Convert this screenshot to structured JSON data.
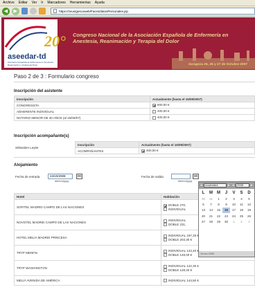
{
  "browser": {
    "menu": [
      "Archivo",
      "Editar",
      "Ver",
      "Ir",
      "Marcadores",
      "Herramientas",
      "Ayuda"
    ],
    "url": "https://zeus/gescoweb/Faces/datosPersonales.jsp"
  },
  "banner": {
    "logo_number": "20°",
    "logo_name": "aseedar-td",
    "logo_sub": "Asociación Española de Enfermería en Anestesia, Reanimación y Terapia del Dolor",
    "title": "Congreso Nacional de la Asociación Española de Enfermería en Anestesia, Reanimación y Terapia del Dolor",
    "date": "Zaragoza 25, 26 y 27 de Octubre 2007"
  },
  "step_title": "Paso 2 de 3 : Formulario congreso",
  "asistente": {
    "title": "Inscripción del asistente",
    "headers": [
      "Inscripción",
      "Actualmente (hasta el 15/09/2007)"
    ],
    "rows": [
      {
        "label": "CONGRESISTA",
        "price": "600,00 €",
        "checked": true
      },
      {
        "label": "ADHERENTE INDIVIDUAL",
        "price": "400,00 €",
        "checked": false
      },
      {
        "label": "NOTARIO MENOR DE 30 AÑOS (al 15/09/07)",
        "price": "400,00 €",
        "checked": false
      }
    ]
  },
  "acompanantes": {
    "title": "Inscripción acompañante(s)",
    "name": "Sébastien Leyter",
    "headers": [
      "Inscripción",
      "Actualmente (hasta el 15/09/2007)"
    ],
    "rows": [
      {
        "label": "ACOMPAÑANTES",
        "price": "400,00 €",
        "checked": true
      }
    ]
  },
  "alojamiento": {
    "title": "Alojamiento",
    "entrada_label": "Fecha de entrada",
    "entrada_value": "24/10/2008",
    "entrada_format": "dd/mm/yyyy",
    "salida_label": "Fecha de salida",
    "salida_value": "",
    "salida_format": "dd/mm/yyyy",
    "headers": [
      "Hotel",
      "Habitación"
    ],
    "hotels": [
      {
        "name": "SOFITEL MADRID CAMPO DE LAS NACIONES",
        "rooms": [
          {
            "label": "DOBLE 270,",
            "checked": true
          },
          {
            "label": "INDIVIDUAL",
            "checked": false
          }
        ]
      },
      {
        "name": "NOVOTEL MADRID CAMPO DE LAS NACIONES",
        "rooms": [
          {
            "label": "INDIVIDUAL",
            "checked": false
          },
          {
            "label": "DOBLE 231,",
            "checked": false
          }
        ]
      },
      {
        "name": "HOTEL MELIA MADRID PRINCESA",
        "rooms": [
          {
            "label": "INDIVIDUAL 197,25 €",
            "checked": false
          },
          {
            "label": "DOBLE 203,30 €",
            "checked": false
          }
        ]
      },
      {
        "name": "TRYP MENFIS",
        "rooms": [
          {
            "label": "INDIVIDUAL 143,40 €",
            "checked": false
          },
          {
            "label": "DOBLE 149,00 €",
            "checked": false
          }
        ]
      },
      {
        "name": "TRYP WASHINGTON",
        "rooms": [
          {
            "label": "INDIVIDUAL 122,30 €",
            "checked": false
          },
          {
            "label": "DOBLE 128,40 €",
            "checked": false
          }
        ]
      },
      {
        "name": "MELIÁ AVENIDA DE AMÉRICA",
        "rooms": [
          {
            "label": "INDIVIDUAL 144,50 €",
            "checked": false
          }
        ]
      }
    ]
  },
  "calendar": {
    "month": "noviembre",
    "year": "2008",
    "dow": [
      "L",
      "M",
      "M",
      "J",
      "V",
      "S",
      "D"
    ],
    "weeks": [
      [
        "30",
        "31",
        "1",
        "2",
        "3",
        "4",
        "5"
      ],
      [
        "6",
        "7",
        "8",
        "9",
        "10",
        "11",
        "12"
      ],
      [
        "13",
        "14",
        "15",
        "16",
        "17",
        "18",
        "19"
      ],
      [
        "20",
        "21",
        "22",
        "23",
        "24",
        "25",
        "26"
      ],
      [
        "27",
        "28",
        "29",
        "30",
        "1",
        "2",
        "3"
      ]
    ],
    "footer": "16-nov-2008"
  }
}
